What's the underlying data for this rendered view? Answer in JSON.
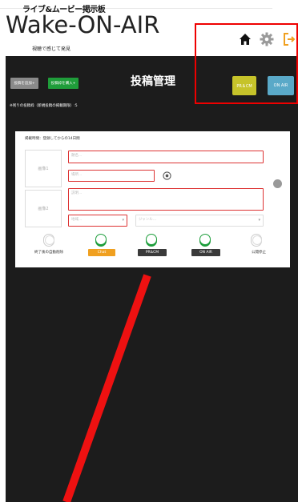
{
  "header": {
    "brand_top": "ライブ&ムービー掲示板",
    "brand_name": "Wake-ON-AIR",
    "brand_sub": "視聴で感じて発見"
  },
  "icons": {
    "home": "home-icon",
    "settings": "gear-icon",
    "logout": "logout-icon"
  },
  "toolbar": {
    "add_post": "投稿を追加+",
    "purchase_posts": "投稿枠を購入+",
    "page_title": "投稿管理",
    "prcm_button": "PR＆CM",
    "onair_button": "ON AIR",
    "remaining": "※残りの投稿枠（新規投稿の掲載期限）:5"
  },
  "form": {
    "period": "掲載時間：登録してからの14日間",
    "image1": "画像1",
    "image2": "画像2",
    "title_placeholder": "題名...",
    "place_placeholder": "場所...",
    "text_placeholder": "説明...",
    "pref_placeholder": "地域...",
    "genre_placeholder": "ジャンル..."
  },
  "toggles": {
    "auto_delete": "終了後の自動削除",
    "chat": "Chat",
    "prcm": "PR&CM",
    "onair": "ON AIR",
    "stop": "公開停止"
  },
  "colors": {
    "accent_green": "#1e9e3c",
    "prcm_yellow": "#c6c32a",
    "onair_blue": "#5aa9c8",
    "chat_orange": "#f0a020",
    "highlight_red": "#e00000"
  }
}
